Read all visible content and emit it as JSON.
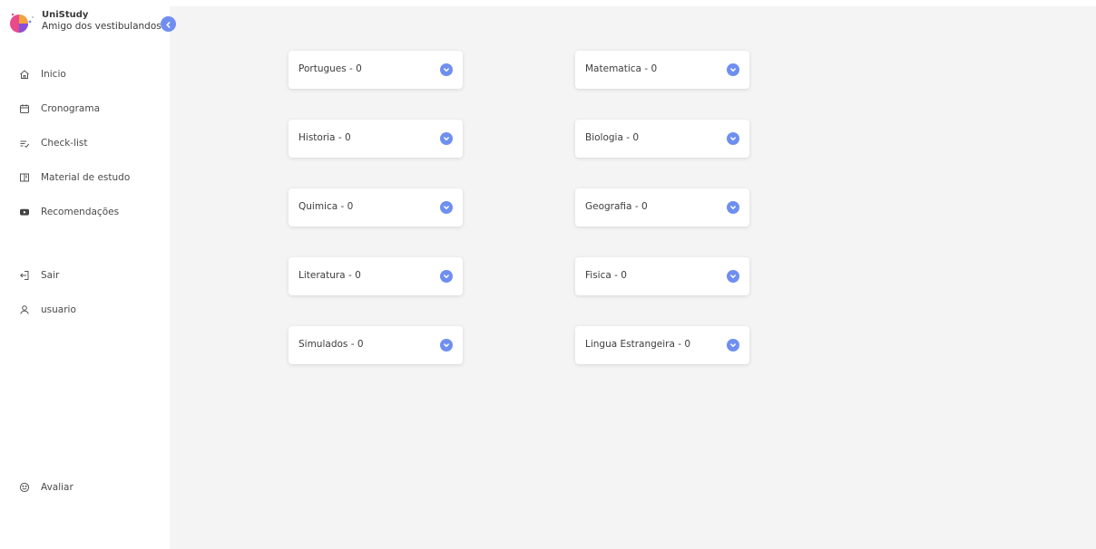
{
  "brand": {
    "title": "UniStudy",
    "subtitle": "Amigo dos vestibulandos"
  },
  "sidebar": {
    "items": [
      {
        "label": "Inicio",
        "icon": "home-icon"
      },
      {
        "label": "Cronograma",
        "icon": "calendar-icon"
      },
      {
        "label": "Check-list",
        "icon": "checklist-icon"
      },
      {
        "label": "Material de estudo",
        "icon": "book-icon"
      },
      {
        "label": "Recomendações",
        "icon": "youtube-icon"
      },
      {
        "label": "Sair",
        "icon": "logout-icon"
      },
      {
        "label": "usuario",
        "icon": "user-icon"
      },
      {
        "label": "Avaliar",
        "icon": "smile-icon"
      }
    ],
    "collapse_icon": "chevron-left-icon"
  },
  "subjects": [
    {
      "label": "Portugues - 0"
    },
    {
      "label": "Matematica - 0"
    },
    {
      "label": "Historia - 0"
    },
    {
      "label": "Biologia - 0"
    },
    {
      "label": "Quimica - 0"
    },
    {
      "label": "Geografia - 0"
    },
    {
      "label": "Literatura - 0"
    },
    {
      "label": "Fisica - 0"
    },
    {
      "label": "Simulados - 0"
    },
    {
      "label": "Lingua Estrangeira - 0"
    }
  ],
  "colors": {
    "accent": "#6f8ff0",
    "main_background": "#f4f4f4",
    "sidebar_background": "#ffffff"
  }
}
